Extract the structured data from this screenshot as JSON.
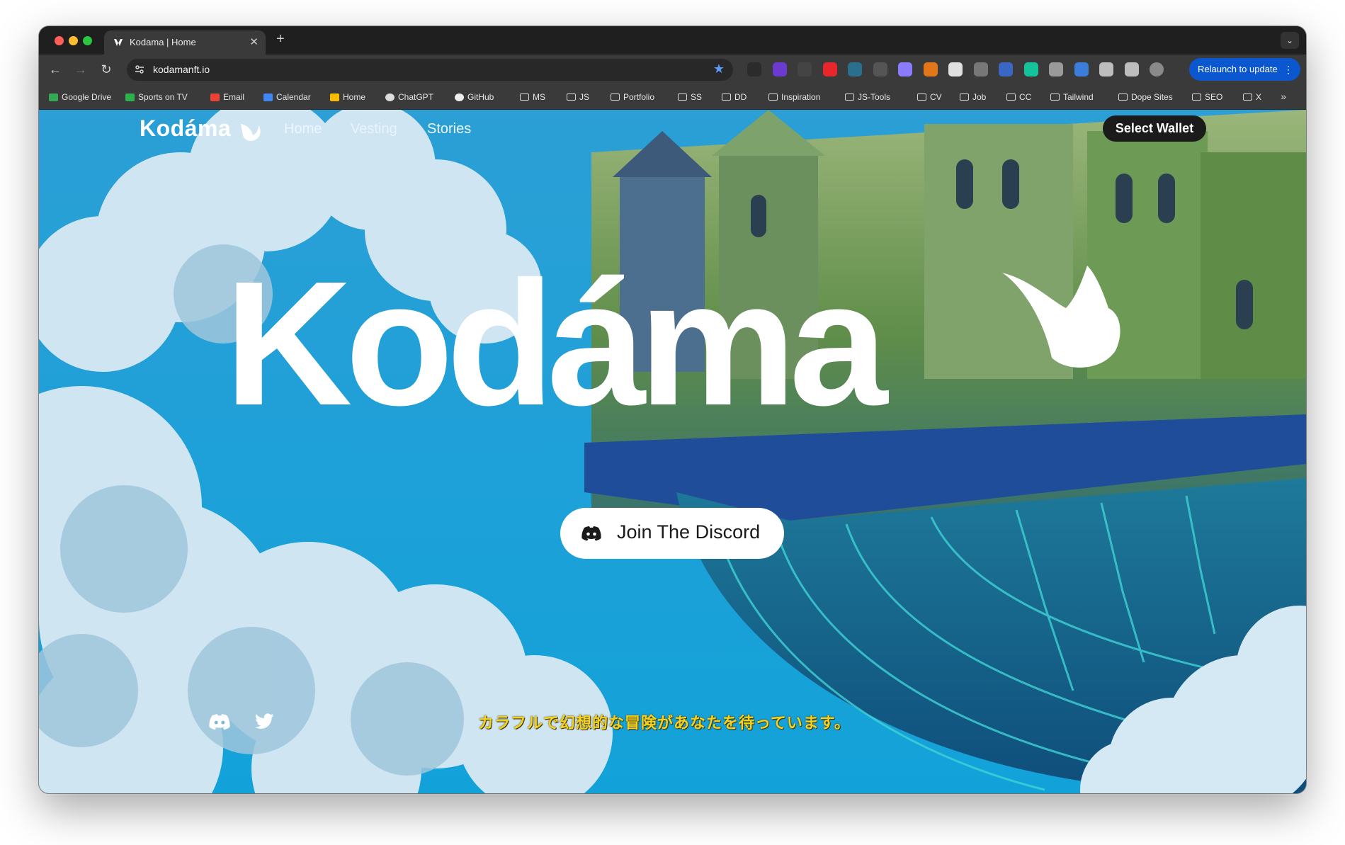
{
  "browser": {
    "tab": {
      "title": "Kodama | Home"
    },
    "address_bar": {
      "url": "kodamanft.io"
    },
    "relaunch_label": "Relaunch to update",
    "extensions": [
      {
        "icon": "new-badge-icon",
        "color": "#2b2b2b"
      },
      {
        "icon": "purple-extension-icon",
        "color": "#6a3ad1"
      },
      {
        "icon": "paint-extension-icon",
        "color": "#444444"
      },
      {
        "icon": "red-extension-icon",
        "color": "#e8262b"
      },
      {
        "icon": "react-devtools-icon",
        "color": "#2b6f8f"
      },
      {
        "icon": "target-extension-icon",
        "color": "#555555"
      },
      {
        "icon": "ghost-extension-icon",
        "color": "#8b7bff"
      },
      {
        "icon": "metamask-icon",
        "color": "#e2761b"
      },
      {
        "icon": "circle-extension-icon",
        "color": "#e0e0e0"
      },
      {
        "icon": "edit-extension-icon",
        "color": "#777777"
      },
      {
        "icon": "colorzilla-icon",
        "color": "#3a66c4"
      },
      {
        "icon": "grammarly-icon",
        "color": "#15c39a"
      },
      {
        "icon": "camera-extension-icon",
        "color": "#9a9a9a"
      },
      {
        "icon": "bridge-extension-icon",
        "color": "#3b7dd8"
      },
      {
        "icon": "puzzle-extensions-icon",
        "color": "#bdbdbd"
      },
      {
        "icon": "reading-list-icon",
        "color": "#bdbdbd"
      },
      {
        "icon": "profile-avatar-icon",
        "color": "#8a8a8a"
      }
    ],
    "bookmarks": [
      {
        "label": "Google Drive",
        "icon": "google-drive-icon"
      },
      {
        "label": "Sports on TV",
        "icon": "sports-tv-icon"
      },
      {
        "label": "Email",
        "icon": "gmail-icon"
      },
      {
        "label": "Calendar",
        "icon": "calendar-icon"
      },
      {
        "label": "Home",
        "icon": "maps-pin-icon"
      },
      {
        "label": "ChatGPT",
        "icon": "chatgpt-icon"
      },
      {
        "label": "GitHub",
        "icon": "github-icon"
      },
      {
        "label": "MS",
        "icon": "folder-icon"
      },
      {
        "label": "JS",
        "icon": "folder-icon"
      },
      {
        "label": "Portfolio",
        "icon": "folder-icon"
      },
      {
        "label": "SS",
        "icon": "folder-icon"
      },
      {
        "label": "DD",
        "icon": "folder-icon"
      },
      {
        "label": "Inspiration",
        "icon": "folder-icon"
      },
      {
        "label": "JS-Tools",
        "icon": "folder-icon"
      },
      {
        "label": "CV",
        "icon": "folder-icon"
      },
      {
        "label": "Job",
        "icon": "folder-icon"
      },
      {
        "label": "CC",
        "icon": "folder-icon"
      },
      {
        "label": "Tailwind",
        "icon": "folder-icon"
      },
      {
        "label": "Dope Sites",
        "icon": "folder-icon"
      },
      {
        "label": "SEO",
        "icon": "folder-icon"
      },
      {
        "label": "X",
        "icon": "folder-icon"
      }
    ]
  },
  "site": {
    "logo": "Kodáma",
    "nav": [
      {
        "label": "Home"
      },
      {
        "label": "Vesting"
      },
      {
        "label": "Stories"
      }
    ],
    "wallet_button": "Select Wallet",
    "hero_title": "Kodáma",
    "discord_button": "Join The Discord",
    "tagline": "カラフルで幻想的な冒険があなたを待っています。",
    "social": [
      {
        "icon": "discord-icon"
      },
      {
        "icon": "twitter-icon"
      }
    ],
    "colors": {
      "sky": "#1ea5d8",
      "castle_green": "#6f9a4a",
      "tagline": "#f4d11c",
      "wallet_bg": "#1b1b1b",
      "accent_blue": "#0b57d0"
    }
  }
}
